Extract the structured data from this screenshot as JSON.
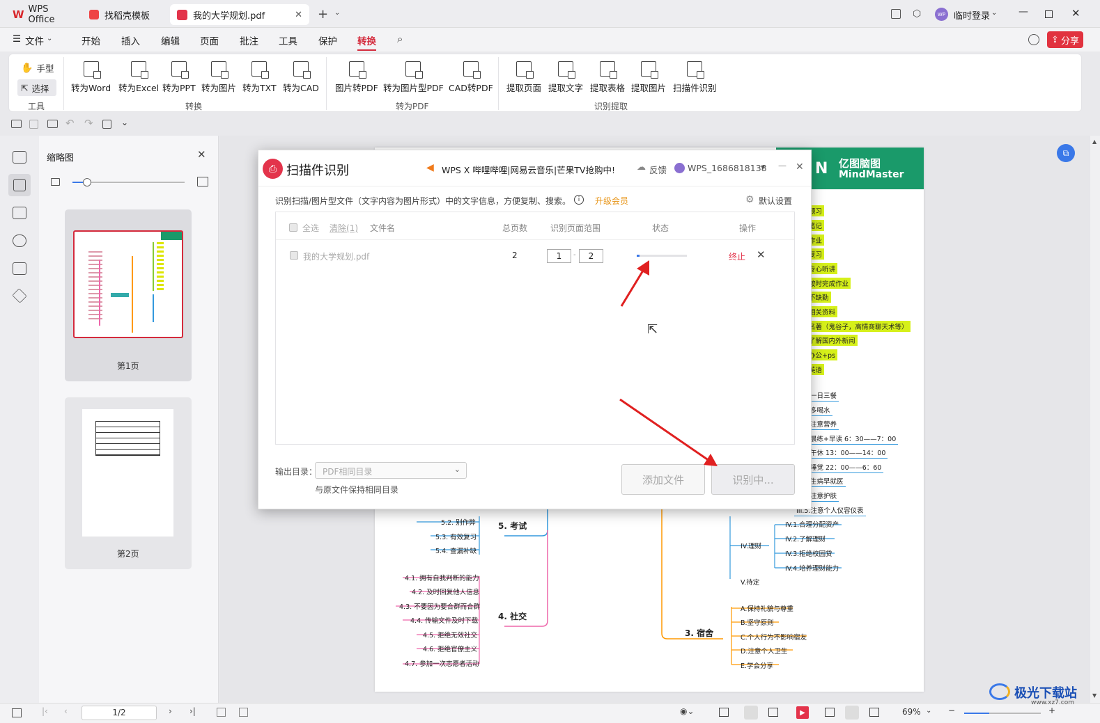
{
  "tabs": [
    {
      "label": "WPS Office"
    },
    {
      "label": "找稻壳模板"
    },
    {
      "label": "我的大学规划.pdf"
    }
  ],
  "window": {
    "login": "临时登录",
    "share": "分享",
    "avatar": "WP"
  },
  "menu": {
    "file": "文件",
    "items": [
      "开始",
      "插入",
      "编辑",
      "页面",
      "批注",
      "工具",
      "保护",
      "转换"
    ],
    "active": "转换"
  },
  "ribbon": {
    "tools": {
      "hand": "手型",
      "select": "选择",
      "group": "工具"
    },
    "convert": {
      "items": [
        "转为Word",
        "转为Excel",
        "转为PPT",
        "转为图片",
        "转为TXT",
        "转为CAD"
      ],
      "group": "转换"
    },
    "to_pdf": {
      "items": [
        "图片转PDF",
        "转为图片型PDF",
        "CAD转PDF"
      ],
      "group": "转为PDF"
    },
    "extract": {
      "items": [
        "提取页面",
        "提取文字",
        "提取表格",
        "提取图片",
        "扫描件识别"
      ],
      "group": "识别提取"
    }
  },
  "sidebar": {
    "title": "缩略图",
    "pages": [
      "第1页",
      "第2页"
    ]
  },
  "dialog": {
    "title": "扫描件识别",
    "promo": "WPS X 哔哩哔哩|网易云音乐|芒果TV抢购中!",
    "feedback": "反馈",
    "user": "WPS_1686818138",
    "desc": "识别扫描/图片型文件（文字内容为图片形式）中的文字信息，方便复制、搜索。",
    "upgrade": "升级会员",
    "settings": "默认设置",
    "headers": {
      "select_all": "全选",
      "clear": "清除(1)",
      "filename": "文件名",
      "total": "总页数",
      "range": "识别页面范围",
      "status": "状态",
      "action": "操作"
    },
    "row": {
      "filename": "我的大学规划.pdf",
      "total": "2",
      "from": "1",
      "to": "2",
      "stop": "终止",
      "progress": 0.05
    },
    "output_label": "输出目录：",
    "output_value": "PDF相同目录",
    "output_hint": "与原文件保持相同目录",
    "add_file": "添加文件",
    "recognizing": "识别中..."
  },
  "mindmap": {
    "brand": "亿图脑图",
    "brand_en": "MindMaster",
    "right_green": [
      "预习",
      "笔记",
      "作业",
      "复习",
      "专心听讲",
      "按时完成作业",
      "不缺勤",
      "相关资料",
      "名著（鬼谷子，高情商聊天术等）",
      "了解国内外新闻",
      "办公+ps",
      "英语"
    ],
    "right_blue": [
      "一日三餐",
      "多喝水",
      "注意营养",
      "晨练+早读 6：30——7：00",
      "午休 13：00——14：00",
      "睡觉 22：00——6：60",
      "生病早就医",
      "注意护肤",
      "III.5.注意个人仪容仪表"
    ],
    "finance": {
      "title": "IV.理财",
      "items": [
        "IV.1.合理分配资产",
        "IV.2.了解理财",
        "IV.3.拒绝校园贷",
        "IV.4.培养理财能力"
      ]
    },
    "v_item": "V.待定",
    "dorm": {
      "title": "3. 宿舍",
      "items": [
        "A.保持礼貌与尊重",
        "B.坚守原则",
        "C.个人行为不影响宿友",
        "D.注意个人卫生",
        "E.学会分享"
      ]
    },
    "exam": {
      "title": "5. 考试",
      "items": [
        "5.2. 别作弊",
        "5.3. 有效复习",
        "5.4. 查漏补缺"
      ]
    },
    "social": {
      "title": "4. 社交",
      "items": [
        "4.1. 拥有自我判断的能力",
        "4.2. 及时回复他人信息",
        "4.3. 不要因为要合群而合群",
        "4.4. 传输文件及时下载",
        "4.5. 拒绝无效社交",
        "4.6. 拒绝官僚主义",
        "4.7. 参加一次志愿者活动"
      ]
    }
  },
  "status": {
    "page": "1/2",
    "zoom": "69%"
  },
  "watermark": "极光下载站",
  "watermark_url": "www.xz7.com"
}
